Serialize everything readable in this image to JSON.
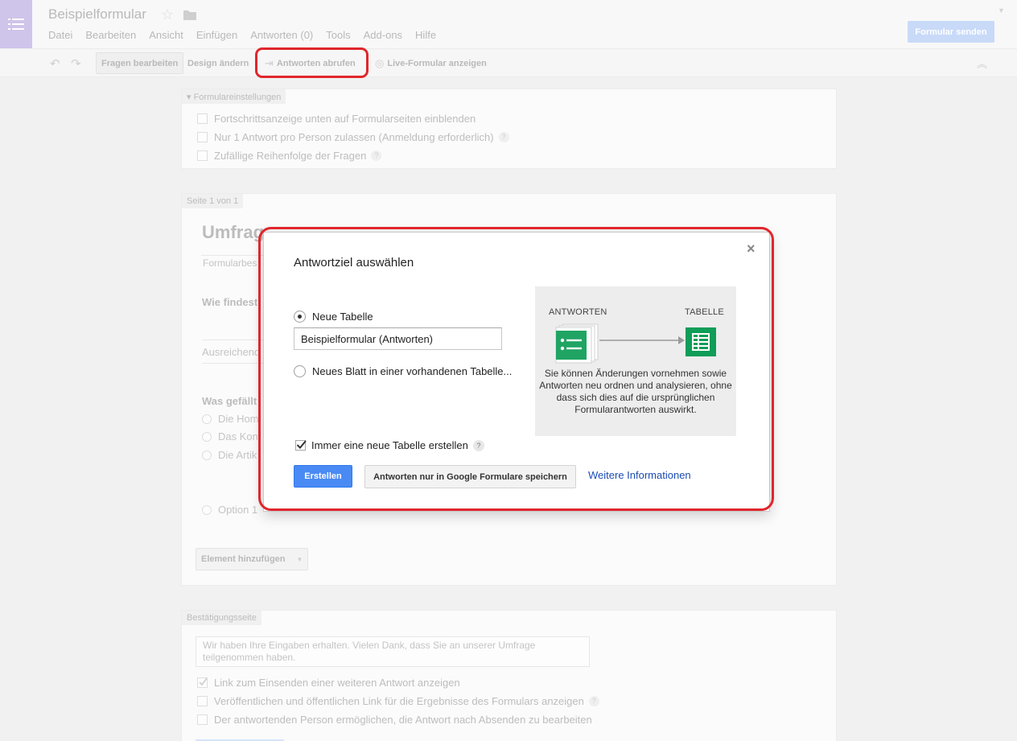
{
  "app": {
    "doc_title": "Beispielformular",
    "menu": [
      "Datei",
      "Bearbeiten",
      "Ansicht",
      "Einfügen",
      "Antworten (0)",
      "Tools",
      "Add-ons",
      "Hilfe"
    ],
    "send_button": "Formular senden"
  },
  "toolbar": {
    "edit_questions": "Fragen bearbeiten",
    "change_design": "Design ändern",
    "get_responses": "Antworten abrufen",
    "live_form": "Live-Formular anzeigen"
  },
  "settings": {
    "header": "Formulareinstellungen",
    "options": [
      {
        "label": "Fortschrittsanzeige unten auf Formularseiten einblenden",
        "checked": false,
        "help": false
      },
      {
        "label": "Nur 1 Antwort pro Person zulassen (Anmeldung erforderlich)",
        "checked": false,
        "help": true
      },
      {
        "label": "Zufällige Reihenfolge der Fragen",
        "checked": false,
        "help": true
      }
    ]
  },
  "page": {
    "page_label": "Seite 1 von 1",
    "title_fragment": "Umfrag",
    "desc_fragment": "Formularbes",
    "q1_fragment": "Wie findest",
    "answer1_fragment": "Ausreichend",
    "q2_fragment": "Was gefällt",
    "options": [
      "Die Hom",
      "Das Kon",
      "Die Artik"
    ],
    "option_new": "Option 1",
    "add_element": "Element hinzufügen"
  },
  "confirmation": {
    "header": "Bestätigungsseite",
    "message": "Wir haben Ihre Eingaben erhalten. Vielen Dank, dass Sie an unserer Umfrage teilgenommen haben.",
    "options": [
      {
        "label": "Link zum Einsenden einer weiteren Antwort anzeigen",
        "checked": true,
        "help": false
      },
      {
        "label": "Veröffentlichen und öffentlichen Link für die Ergebnisse des Formulars anzeigen",
        "checked": false,
        "help": true
      },
      {
        "label": "Der antwortenden Person ermöglichen, die Antwort nach Absenden zu bearbeiten",
        "checked": false,
        "help": false
      }
    ]
  },
  "dialog": {
    "title": "Antwortziel auswählen",
    "close": "×",
    "option_new_sheet": "Neue Tabelle",
    "option_new_sheet_selected": true,
    "sheet_name": "Beispielformular (Antworten)",
    "option_existing": "Neues Blatt in einer vorhandenen Tabelle...",
    "always_new": "Immer eine neue Tabelle erstellen",
    "always_new_checked": true,
    "help": "?",
    "create_button": "Erstellen",
    "save_only_button": "Antworten nur in Google Formulare speichern",
    "more_info_link": "Weitere Informationen",
    "info": {
      "label_responses": "ANTWORTEN",
      "label_sheet": "TABELLE",
      "description": "Sie können Änderungen vornehmen sowie Antworten neu ordnen und analysieren, ohne dass sich dies auf die ursprünglichen Formularantworten auswirkt."
    }
  },
  "colors": {
    "accent_blue": "#4a8af4",
    "forms_green": "#1fa463",
    "sheets_green": "#0f9d58",
    "annotation_red": "#e0262c",
    "link": "#1a4bb4"
  }
}
